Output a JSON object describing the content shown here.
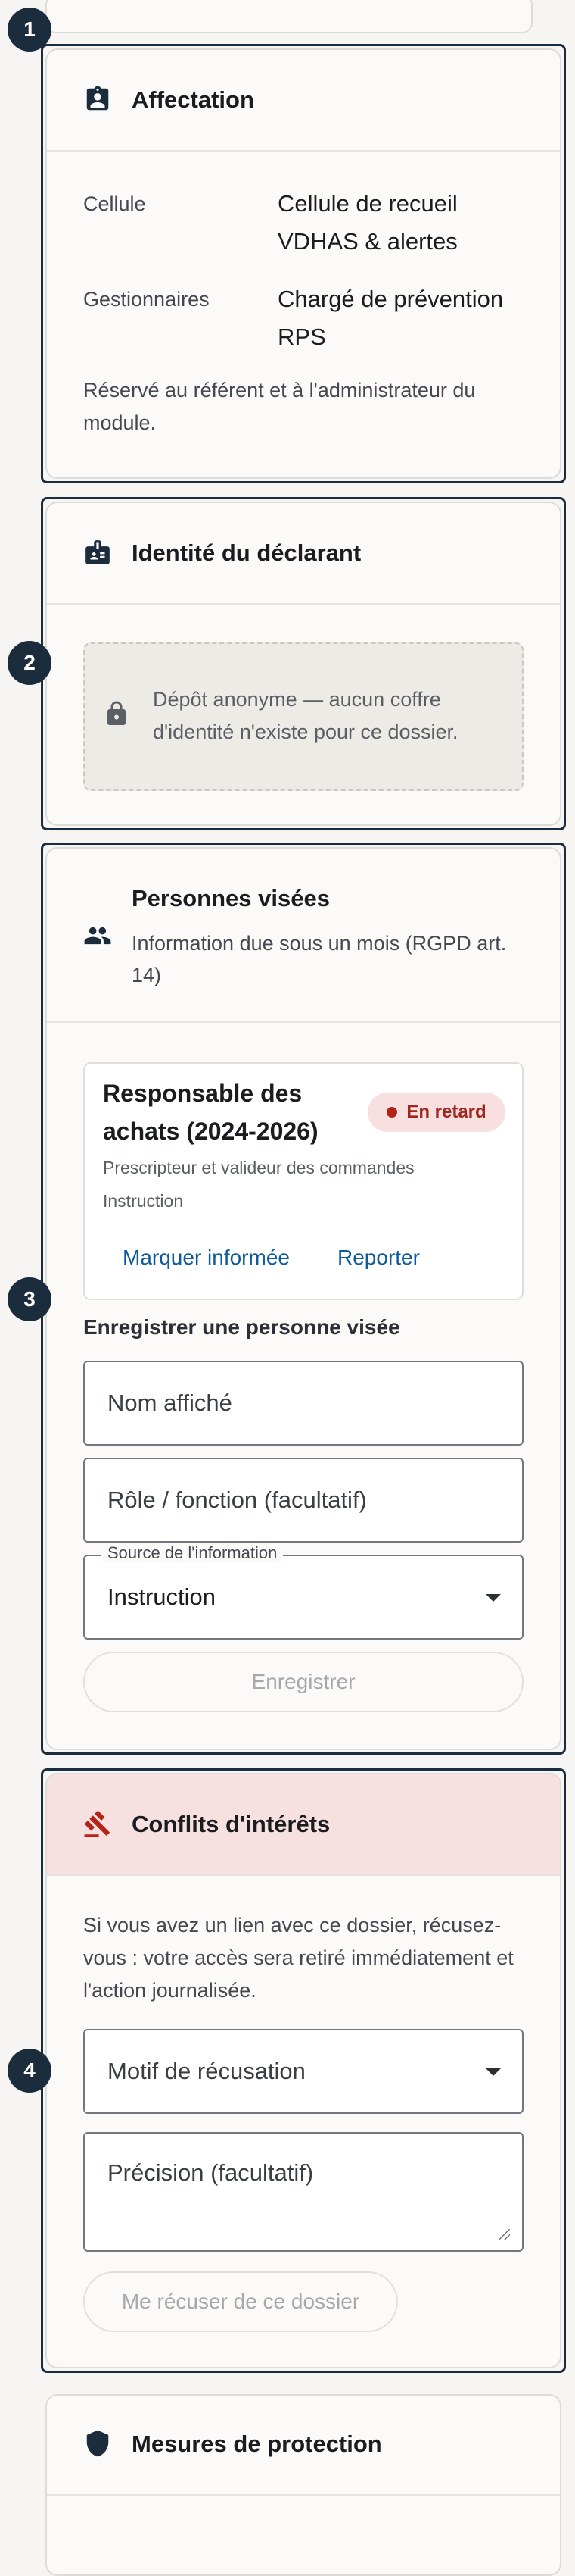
{
  "markers": [
    "1",
    "2",
    "3",
    "4"
  ],
  "affectation": {
    "title": "Affectation",
    "rows": [
      {
        "label": "Cellule",
        "value": "Cellule de recueil VDHAS & alertes"
      },
      {
        "label": "Gestionnaires",
        "value": "Chargé de prévention RPS"
      }
    ],
    "note": "Réservé au référent et à l'administrateur du module."
  },
  "identite": {
    "title": "Identité du déclarant",
    "anonymous_text": "Dépôt anonyme — aucun coffre d'identité n'existe pour ce dossier."
  },
  "personnes": {
    "title": "Personnes visées",
    "subtitle": "Information due sous un mois (RGPD art. 14)",
    "person": {
      "name": "Responsable des achats (2024-2026)",
      "badge": "En retard",
      "role": "Prescripteur et valideur des commandes",
      "source": "Instruction",
      "action_informed": "Marquer informée",
      "action_postpone": "Reporter"
    },
    "form": {
      "title": "Enregistrer une personne visée",
      "name_placeholder": "Nom affiché",
      "role_placeholder": "Rôle / fonction (facultatif)",
      "source_label": "Source de l'information",
      "source_value": "Instruction",
      "submit": "Enregistrer"
    }
  },
  "conflits": {
    "title": "Conflits d'intérêts",
    "text": "Si vous avez un lien avec ce dossier, récusez-vous : votre accès sera retiré immédiatement et l'action journalisée.",
    "motif_placeholder": "Motif de récusation",
    "precision_placeholder": "Précision (facultatif)",
    "button": "Me récuser de ce dossier",
    "header_bg": "#f7e1e0",
    "icon_color": "#b42318"
  },
  "mesures": {
    "title": "Mesures de protection"
  },
  "colors": {
    "accent": "#1b2c3d",
    "link": "#0e5a9b",
    "late": "#b42318"
  }
}
